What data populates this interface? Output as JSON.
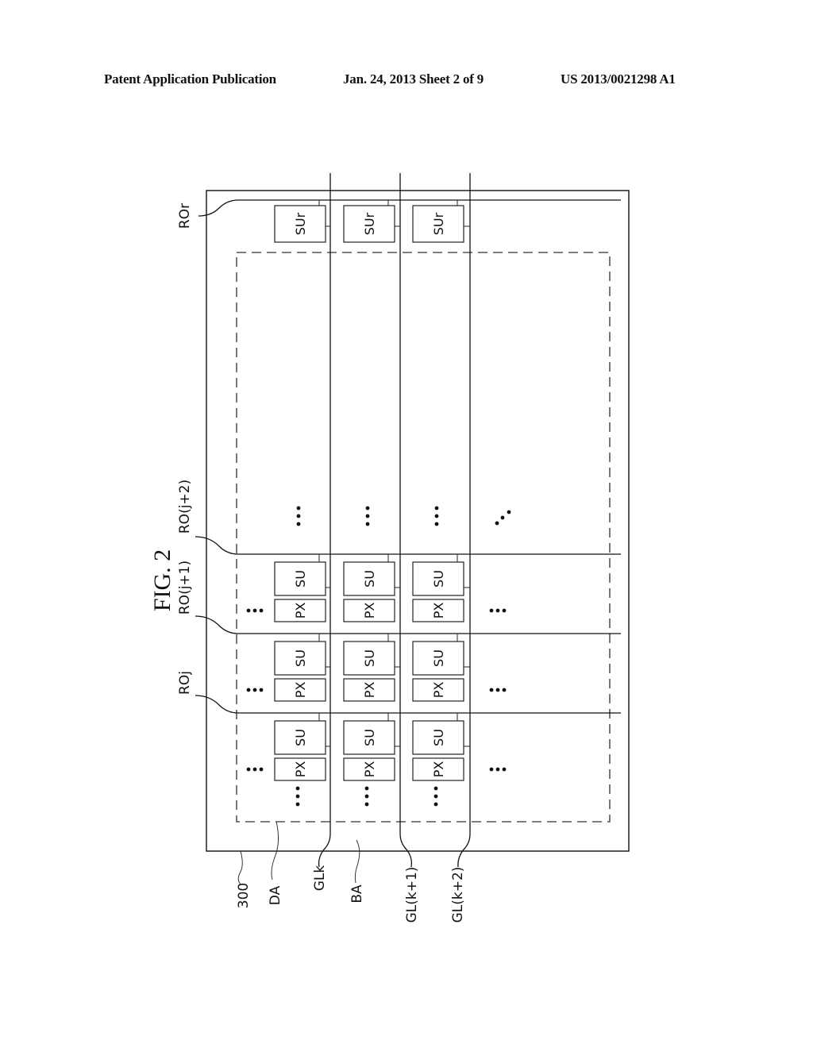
{
  "header": {
    "publication": "Patent Application Publication",
    "date_sheet": "Jan. 24, 2013   Sheet 2 of 9",
    "number": "US 2013/0021298 A1"
  },
  "figure": {
    "title": "FIG. 2",
    "reference_labels": {
      "panel": "300",
      "display_area": "DA",
      "border_area": "BA",
      "gate_line_k": "GLk",
      "gate_line_k1": "GL(k+1)",
      "gate_line_k2": "GL(k+2)",
      "readout_r": "ROr",
      "readout_j": "ROj",
      "readout_j1": "RO(j+1)",
      "readout_j2": "RO(j+2)"
    },
    "box_labels": {
      "sensing_unit": "SU",
      "sensing_unit_r": "SUr",
      "pixel": "PX"
    },
    "ellipsis": "⋯"
  }
}
